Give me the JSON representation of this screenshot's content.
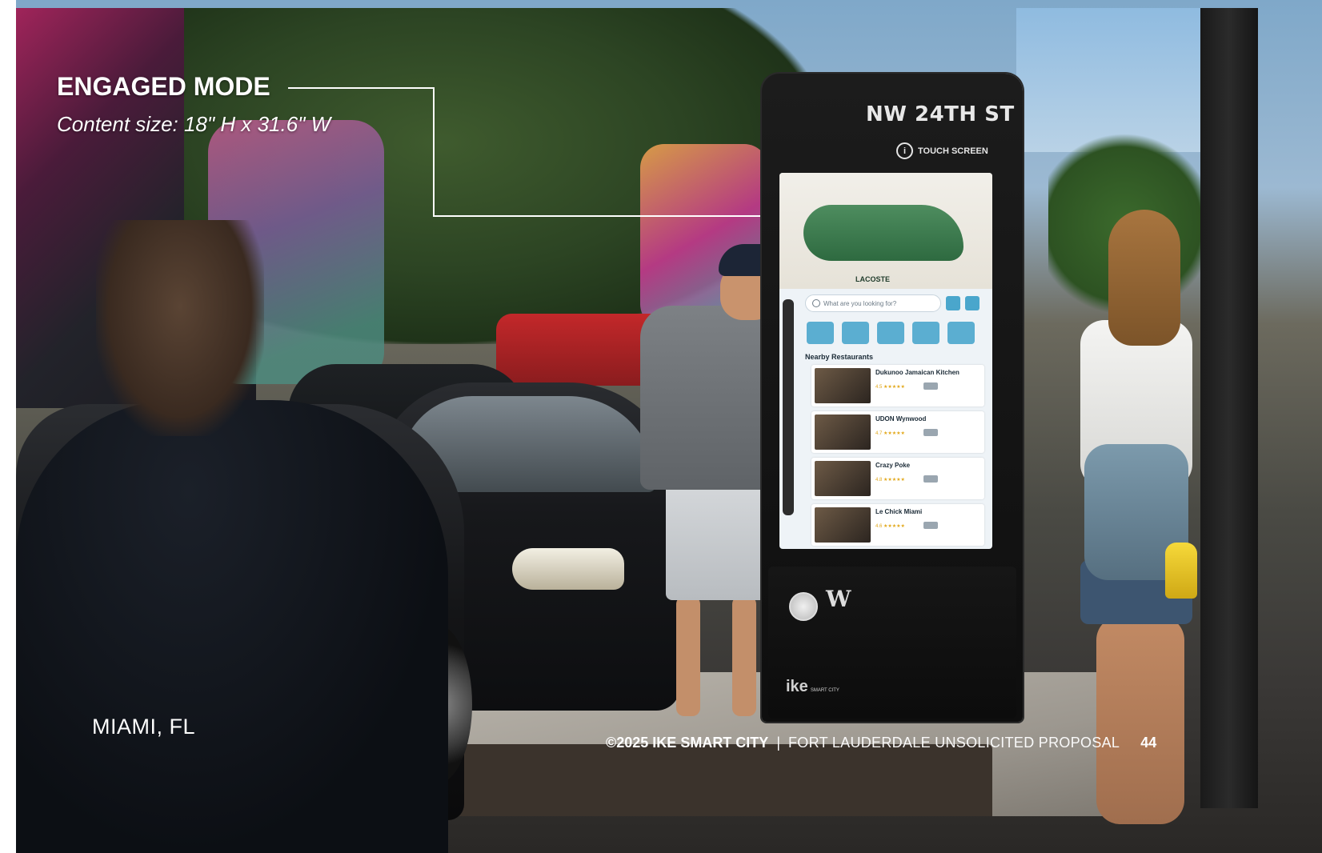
{
  "overlay": {
    "heading": "ENGAGED MODE",
    "subheading": "Content size: 18\" H x 31.6\" W"
  },
  "location": "MIAMI, FL",
  "footer": {
    "copyright": "©2025 IKE SMART CITY",
    "separator": "|",
    "proposal": "FORT LAUDERDALE UNSOLICITED PROPOSAL",
    "page_number": "44"
  },
  "kiosk": {
    "street_sign": "NW 24TH ST",
    "touch_label": "TOUCH SCREEN",
    "info_icon": "i",
    "ad_label": "LACOSTE",
    "search_placeholder": "What are you looking for?",
    "section_title": "Nearby Restaurants",
    "restaurants": [
      {
        "name": "Dukunoo Jamaican Kitchen",
        "rating": "4.5 ★★★★★"
      },
      {
        "name": "UDON Wynwood",
        "rating": "4.7 ★★★★★"
      },
      {
        "name": "Crazy Poke",
        "rating": "4.8 ★★★★★"
      },
      {
        "name": "Le Chick Miami",
        "rating": "4.6 ★★★★★"
      }
    ],
    "brand": "ike",
    "brand_sub": "SMART CITY",
    "partner_logo": "W"
  },
  "colors": {
    "overlay_text": "#ffffff",
    "kiosk_body": "#111111",
    "screen_accent": "#4aa6cc",
    "callout_line": "#ffffff"
  }
}
